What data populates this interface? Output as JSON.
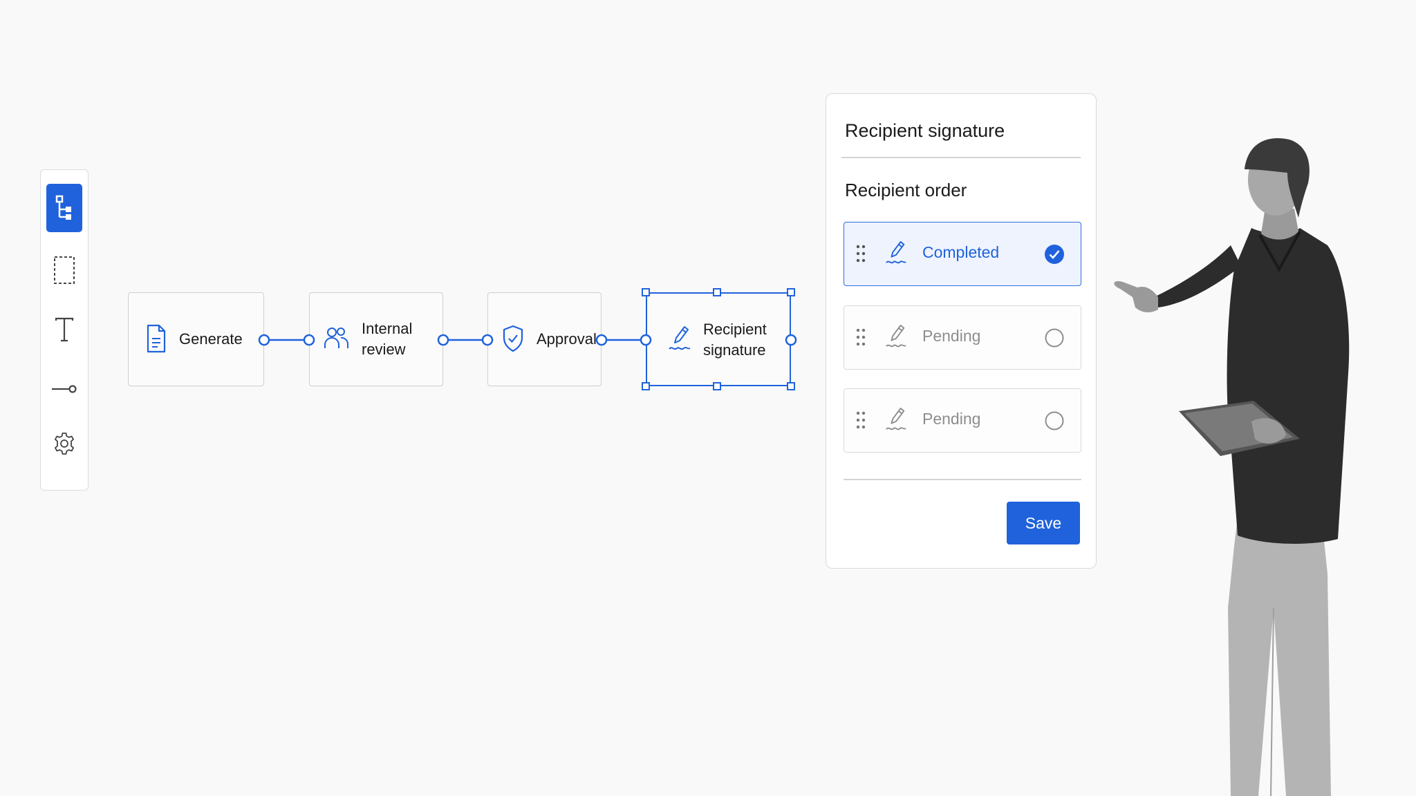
{
  "toolbar": {
    "items": [
      {
        "icon": "workflow-tree-icon",
        "active": true
      },
      {
        "icon": "selection-marquee-icon",
        "active": false
      },
      {
        "icon": "text-tool-icon",
        "active": false
      },
      {
        "icon": "connector-tool-icon",
        "active": false
      },
      {
        "icon": "gear-icon",
        "active": false
      }
    ]
  },
  "workflow": {
    "steps": [
      {
        "label": "Generate",
        "icon": "document-icon"
      },
      {
        "label": "Internal\nreview",
        "icon": "users-icon"
      },
      {
        "label": "Approval",
        "icon": "shield-check-icon"
      },
      {
        "label": "Recipient\nsignature",
        "icon": "signature-pen-icon",
        "selected": true
      }
    ]
  },
  "panel": {
    "title": "Recipient signature",
    "section_title": "Recipient order",
    "recipients": [
      {
        "status": "Completed",
        "done": true
      },
      {
        "status": "Pending",
        "done": false
      },
      {
        "status": "Pending",
        "done": false
      }
    ],
    "save_label": "Save"
  },
  "colors": {
    "accent": "#1f62dc",
    "completed_bg": "#eef3fd",
    "pending_text": "#8d8d8d",
    "border": "#d9d9d9"
  }
}
